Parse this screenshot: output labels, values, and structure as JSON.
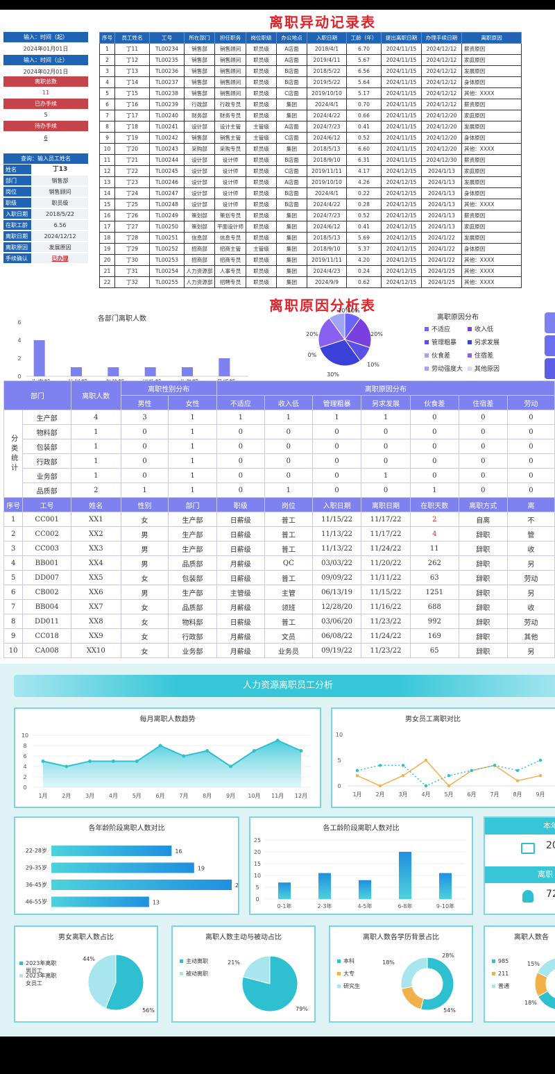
{
  "title1": "离职异动记录表",
  "title2": "离职原因分析表",
  "sidebar": {
    "start_label": "输入：时间（起）",
    "start_value": "2024年01月01日",
    "end_label": "输入：时间（止）",
    "end_value": "2024年02月01日",
    "total_label": "离职总数",
    "total_value": "11",
    "done_label": "已办手续",
    "done_value": "5",
    "pending_label": "待办手续",
    "pending_value": "6",
    "query_label": "查询：输入员工姓名",
    "fields": [
      {
        "k": "姓名",
        "v": "丁13"
      },
      {
        "k": "部门",
        "v": "销售部"
      },
      {
        "k": "岗位",
        "v": "销售顾问"
      },
      {
        "k": "职级",
        "v": "职员级"
      },
      {
        "k": "入职日期",
        "v": "2018/5/22"
      },
      {
        "k": "在职工龄",
        "v": "6.56"
      },
      {
        "k": "离职日期",
        "v": "2024/12/12"
      },
      {
        "k": "离职原因",
        "v": "发展原因"
      },
      {
        "k": "手续确认",
        "v": "已办理"
      }
    ]
  },
  "record_table": {
    "headers": [
      "序号",
      "员工姓名",
      "工号",
      "所在部门",
      "担任职务",
      "岗位职级",
      "办公地点",
      "入职日期",
      "工龄（年）",
      "提出离职日期",
      "办理手续日期",
      "离职原因"
    ],
    "rows": [
      [
        "1",
        "丁11",
        "TL00234",
        "销售部",
        "销售顾问",
        "职员级",
        "A店面",
        "2018/4/1",
        "6.70",
        "2024/11/15",
        "2024/12/12",
        "薪资原因"
      ],
      [
        "2",
        "丁12",
        "TL00235",
        "销售部",
        "销售顾问",
        "职员级",
        "A店面",
        "2019/4/11",
        "5.67",
        "2024/11/15",
        "2024/12/12",
        "家庭原因"
      ],
      [
        "3",
        "丁13",
        "TL00236",
        "销售部",
        "销售顾问",
        "职员级",
        "B店面",
        "2018/5/22",
        "6.56",
        "2024/11/15",
        "2024/12/12",
        "发展原因"
      ],
      [
        "4",
        "丁14",
        "TL00237",
        "销售部",
        "销售顾问",
        "职员级",
        "B店面",
        "2019/5/22",
        "5.64",
        "2024/11/15",
        "2024/12/12",
        "身体原因"
      ],
      [
        "5",
        "丁15",
        "TL00238",
        "销售部",
        "销售顾问",
        "职员级",
        "C店面",
        "2019/10/10",
        "5.17",
        "2024/11/15",
        "2024/12/12",
        "其他：XXXX"
      ],
      [
        "6",
        "丁16",
        "TL00239",
        "行政部",
        "行政专员",
        "职员级",
        "集团",
        "2024/4/1",
        "0.70",
        "2024/11/15",
        "2024/12/12",
        "薪资原因"
      ],
      [
        "7",
        "丁17",
        "TL00240",
        "财务部",
        "财务专员",
        "职员级",
        "集团",
        "2024/4/22",
        "0.66",
        "2024/11/15",
        "2024/12/20",
        "家庭原因"
      ],
      [
        "8",
        "丁18",
        "TL00241",
        "设计部",
        "设计主管",
        "主管级",
        "A店面",
        "2024/7/23",
        "0.41",
        "2024/11/15",
        "2024/12/20",
        "发展原因"
      ],
      [
        "9",
        "丁19",
        "TL00242",
        "销售部",
        "销售主管",
        "主管级",
        "C店面",
        "2024/6/12",
        "0.52",
        "2024/11/15",
        "2024/12/20",
        "身体原因"
      ],
      [
        "10",
        "丁20",
        "TL00243",
        "采购部",
        "采购专员",
        "职员级",
        "集团",
        "2018/5/13",
        "6.60",
        "2024/11/15",
        "2024/12/20",
        "其他：XXXX"
      ],
      [
        "11",
        "丁21",
        "TL00244",
        "设计部",
        "设计师",
        "职员级",
        "B店面",
        "2018/9/10",
        "6.31",
        "2024/11/15",
        "2024/12/30",
        "薪资原因"
      ],
      [
        "12",
        "丁22",
        "TL00245",
        "设计部",
        "设计师",
        "职员级",
        "C店面",
        "2019/11/11",
        "4.17",
        "2024/12/15",
        "2024/1/13",
        "家庭原因"
      ],
      [
        "13",
        "丁23",
        "TL00246",
        "设计部",
        "设计师",
        "职员级",
        "A店面",
        "2019/10/10",
        "4.26",
        "2024/12/15",
        "2024/1/13",
        "发展原因"
      ],
      [
        "14",
        "丁24",
        "TL00247",
        "设计部",
        "设计师",
        "职员级",
        "B店面",
        "2024/4/1",
        "0.22",
        "2024/12/15",
        "2024/1/13",
        "身体原因"
      ],
      [
        "15",
        "丁25",
        "TL00248",
        "设计部",
        "设计师",
        "职员级",
        "B店面",
        "2024/4/22",
        "0.28",
        "2024/12/15",
        "2024/1/13",
        "其他：XXXX"
      ],
      [
        "16",
        "丁26",
        "TL00249",
        "策划部",
        "策划专员",
        "职员级",
        "集团",
        "2024/7/23",
        "0.52",
        "2024/12/15",
        "2024/1/13",
        "薪资原因"
      ],
      [
        "17",
        "丁27",
        "TL00250",
        "策划部",
        "平面设计师",
        "职员级",
        "集团",
        "2024/6/12",
        "0.41",
        "2024/12/15",
        "2024/1/13",
        "家庭原因"
      ],
      [
        "18",
        "丁28",
        "TL00251",
        "信息部",
        "信息专员",
        "职员级",
        "集团",
        "2018/5/13",
        "5.69",
        "2024/12/15",
        "2024/1/22",
        "发展原因"
      ],
      [
        "19",
        "丁29",
        "TL00252",
        "招商部",
        "招商主管",
        "主管级",
        "集团",
        "2018/9/10",
        "5.37",
        "2024/12/15",
        "2024/1/22",
        "身体原因"
      ],
      [
        "20",
        "丁30",
        "TL00253",
        "招商部",
        "招商专员",
        "职员级",
        "集团",
        "2019/11/11",
        "4.20",
        "2024/12/15",
        "2024/1/22",
        "其他：XXXX"
      ],
      [
        "21",
        "丁31",
        "TL00254",
        "人力资源部",
        "人事专员",
        "职员级",
        "集团",
        "2024/4/23",
        "0.24",
        "2024/12/15",
        "2024/1/25",
        "其他：XXXX"
      ],
      [
        "22",
        "丁32",
        "TL00255",
        "人力资源部",
        "招聘专员",
        "职员级",
        "集团",
        "2024/9/9",
        "0.62",
        "2024/12/15",
        "2024/1/25",
        "其他：XXXX"
      ]
    ]
  },
  "chart_data": [
    {
      "type": "bar",
      "title": "各部门离职人数",
      "categories": [
        "生产部",
        "物料部",
        "包装部",
        "行政部",
        "业务部",
        "品质部"
      ],
      "values": [
        4,
        1,
        1,
        1,
        1,
        2
      ],
      "ylim": [
        0,
        6
      ],
      "yticks": [
        0,
        2,
        4,
        6
      ],
      "color": "#7e82f0"
    },
    {
      "type": "pie",
      "title": "离职原因分布",
      "labels": [
        "不适应",
        "收入低",
        "管理粗暴",
        "另求发展",
        "伙食差",
        "住宿差",
        "劳动强度大",
        "其他原因"
      ],
      "values": [
        10,
        20,
        10,
        30,
        0,
        20,
        10,
        0
      ],
      "label_texts": [
        "10%",
        "20%",
        "10%",
        "30%",
        "0%",
        "20%",
        "10%"
      ],
      "colors": [
        "#6c63ff",
        "#7a3fe0",
        "#5a4fe6",
        "#3b40d8",
        "#b49af0",
        "#8a60f0",
        "#9fa4f5",
        "#d8d9f7"
      ]
    },
    {
      "type": "area",
      "title": "每月离职人数趋势",
      "categories": [
        "1月",
        "2月",
        "3月",
        "4月",
        "5月",
        "6月",
        "7月",
        "8月",
        "9月",
        "10月",
        "11月",
        "12月"
      ],
      "values": [
        5,
        4,
        5,
        5,
        5,
        8,
        6,
        7,
        4,
        7,
        9,
        7
      ],
      "ylim": [
        0,
        10
      ],
      "yticks": [
        0,
        2,
        4,
        6,
        8,
        10
      ]
    },
    {
      "type": "line",
      "title": "男女员工离职对比",
      "categories": [
        "1月",
        "2月",
        "3月",
        "4月",
        "5月",
        "6月",
        "7月",
        "8月",
        "9月"
      ],
      "series": [
        {
          "values": [
            2,
            0,
            2,
            5,
            0,
            3,
            4,
            1,
            2
          ],
          "color": "#f0b14a"
        },
        {
          "values": [
            3,
            4,
            4,
            0,
            2,
            3,
            4,
            3,
            5
          ],
          "color": "#2ec0d0"
        }
      ],
      "ylim": [
        0,
        10
      ],
      "yticks": [
        0,
        5,
        10
      ]
    },
    {
      "type": "bar",
      "orientation": "horizontal",
      "title": "各年龄阶段离职人数对比",
      "categories": [
        "22-28岁",
        "29-35岁",
        "36-45岁",
        "46-55岁"
      ],
      "values": [
        16,
        19,
        24,
        13
      ],
      "xlim": [
        0,
        24
      ]
    },
    {
      "type": "bar",
      "title": "各工龄阶段离职人数对比",
      "categories": [
        "0-1年",
        "2-3年",
        "4-5年",
        "6-8年",
        "9-10年"
      ],
      "values": [
        7,
        11,
        8,
        20,
        11
      ],
      "ylim": [
        0,
        25
      ],
      "yticks": [
        0,
        5,
        10,
        15,
        20,
        25
      ]
    },
    {
      "type": "pie",
      "title": "男女离职人数占比",
      "labels": [
        "2023年离职男员工",
        "2023年离职女员工"
      ],
      "values": [
        56,
        44
      ],
      "label_texts": [
        "56%",
        "44%"
      ]
    },
    {
      "type": "pie",
      "title": "离职人数主动与被动占比",
      "labels": [
        "主动离职",
        "被动离职"
      ],
      "values": [
        79,
        21
      ],
      "label_texts": [
        "79%",
        "21%"
      ]
    },
    {
      "type": "donut",
      "title": "离职人数各学历背景占比",
      "labels": [
        "本科",
        "大专",
        "研究生"
      ],
      "values": [
        54,
        18,
        28
      ],
      "label_texts": [
        "54%",
        "18%",
        "28%"
      ]
    },
    {
      "type": "donut",
      "title": "离职人数各",
      "labels": [
        "985",
        "211",
        "普通"
      ],
      "values": [
        67,
        15,
        18
      ],
      "label_texts": [
        "15%",
        "18%"
      ]
    }
  ],
  "reason_table": {
    "dept_header": "部门",
    "count_header": "离职人数",
    "gender_header": "离职性别分布",
    "reason_header": "离职原因分布",
    "male": "男性",
    "female": "女性",
    "reasons": [
      "不适应",
      "收入低",
      "管理粗暴",
      "另求发展",
      "伙食差",
      "住宿差",
      "劳动"
    ],
    "cat_label": "分类统计",
    "rows": [
      {
        "dept": "生产部",
        "n": "4",
        "m": "3",
        "f": "1",
        "r": [
          "1",
          "1",
          "1",
          "1",
          "0",
          "0",
          "0"
        ]
      },
      {
        "dept": "物料部",
        "n": "1",
        "m": "0",
        "f": "1",
        "r": [
          "0",
          "0",
          "0",
          "0",
          "0",
          "0",
          "0"
        ]
      },
      {
        "dept": "包装部",
        "n": "1",
        "m": "0",
        "f": "1",
        "r": [
          "0",
          "0",
          "0",
          "0",
          "0",
          "0",
          "0"
        ]
      },
      {
        "dept": "行政部",
        "n": "1",
        "m": "0",
        "f": "1",
        "r": [
          "0",
          "0",
          "0",
          "0",
          "0",
          "0",
          "0"
        ]
      },
      {
        "dept": "业务部",
        "n": "1",
        "m": "0",
        "f": "1",
        "r": [
          "0",
          "0",
          "0",
          "1",
          "0",
          "0",
          "0"
        ]
      },
      {
        "dept": "品质部",
        "n": "2",
        "m": "1",
        "f": "1",
        "r": [
          "0",
          "1",
          "0",
          "0",
          "1",
          "0",
          "0"
        ]
      }
    ]
  },
  "staff_table": {
    "headers": [
      "序号",
      "工号",
      "姓名",
      "性别",
      "部门",
      "职级",
      "岗位",
      "入职日期",
      "离职日期",
      "在职天数",
      "离职方式",
      "离"
    ],
    "rows": [
      [
        "1",
        "CC001",
        "XX1",
        "女",
        "生产部",
        "日薪级",
        "普工",
        "11/15/22",
        "11/17/22",
        "2",
        "自离",
        "不"
      ],
      [
        "2",
        "CC002",
        "XX2",
        "男",
        "生产部",
        "日薪级",
        "普工",
        "11/13/22",
        "11/17/22",
        "4",
        "辞职",
        "管"
      ],
      [
        "3",
        "CC003",
        "XX3",
        "男",
        "生产部",
        "日薪级",
        "普工",
        "11/13/22",
        "11/24/22",
        "11",
        "辞职",
        "收"
      ],
      [
        "4",
        "BB001",
        "XX4",
        "男",
        "品质部",
        "月薪级",
        "QC",
        "03/03/22",
        "11/20/22",
        "262",
        "辞职",
        "另"
      ],
      [
        "5",
        "DD007",
        "XX5",
        "女",
        "包装部",
        "日薪级",
        "普工",
        "09/09/22",
        "11/11/22",
        "63",
        "辞职",
        "劳动"
      ],
      [
        "6",
        "CB002",
        "XX6",
        "男",
        "生产部",
        "主管级",
        "主管",
        "06/13/19",
        "11/15/22",
        "1251",
        "辞职",
        "另"
      ],
      [
        "7",
        "BB004",
        "XX7",
        "女",
        "品质部",
        "月薪级",
        "领班",
        "12/28/20",
        "11/16/22",
        "688",
        "辞职",
        "收"
      ],
      [
        "8",
        "DD011",
        "XX8",
        "女",
        "物料部",
        "日薪级",
        "普工",
        "03/06/20",
        "11/23/22",
        "992",
        "辞职",
        "劳动"
      ],
      [
        "9",
        "CC018",
        "XX9",
        "女",
        "行政部",
        "月薪级",
        "文员",
        "06/08/22",
        "11/24/22",
        "169",
        "辞职",
        "其他"
      ],
      [
        "10",
        "CA008",
        "XX10",
        "女",
        "业务部",
        "月薪级",
        "业务员",
        "09/19/22",
        "11/23/22",
        "65",
        "辞职",
        "另"
      ]
    ]
  },
  "dashboard": {
    "banner": "人力资源离职员工分析",
    "card1_title": "本年",
    "card1_value": "20",
    "card2_title": "离职",
    "card2_value": "72"
  }
}
